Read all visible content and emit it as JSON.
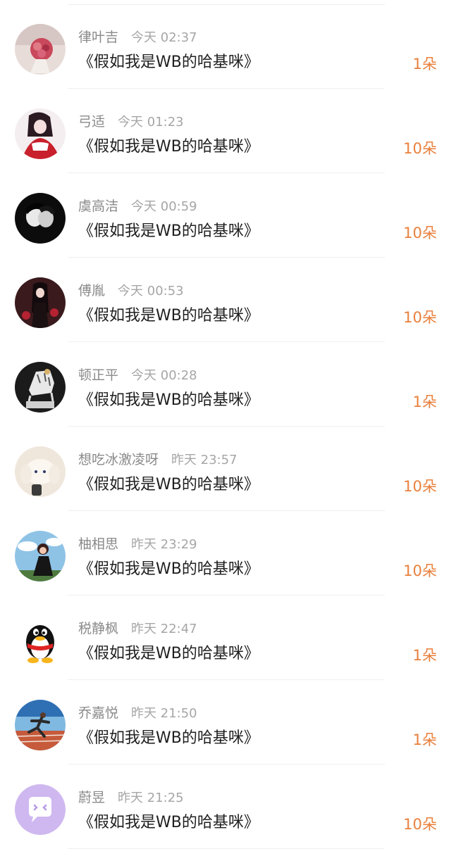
{
  "gift_list": {
    "items": [
      {
        "name": "律叶吉",
        "time": "今天 02:37",
        "message": "《假如我是WB的哈基咪》",
        "count": "1朵",
        "avatar_icon": "bouquet-photo-icon"
      },
      {
        "name": "弓适",
        "time": "今天 01:23",
        "message": "《假如我是WB的哈基咪》",
        "count": "10朵",
        "avatar_icon": "anime-girl-avatar-icon"
      },
      {
        "name": "虞高洁",
        "time": "今天 00:59",
        "message": "《假如我是WB的哈基咪》",
        "count": "10朵",
        "avatar_icon": "dark-couple-avatar-icon"
      },
      {
        "name": "傅胤",
        "time": "今天 00:53",
        "message": "《假如我是WB的哈基咪》",
        "count": "10朵",
        "avatar_icon": "dark-anime-avatar-icon"
      },
      {
        "name": "顿正平",
        "time": "今天 00:28",
        "message": "《假如我是WB的哈基咪》",
        "count": "1朵",
        "avatar_icon": "tiger-statue-avatar-icon"
      },
      {
        "name": "想吃冰激凌呀",
        "time": "昨天 23:57",
        "message": "《假如我是WB的哈基咪》",
        "count": "10朵",
        "avatar_icon": "cinnamoroll-plush-avatar-icon"
      },
      {
        "name": "柚相思",
        "time": "昨天 23:29",
        "message": "《假如我是WB的哈基咪》",
        "count": "10朵",
        "avatar_icon": "sky-portrait-avatar-icon"
      },
      {
        "name": "税静枫",
        "time": "昨天 22:47",
        "message": "《假如我是WB的哈基咪》",
        "count": "1朵",
        "avatar_icon": "qq-penguin-avatar-icon"
      },
      {
        "name": "乔嘉悦",
        "time": "昨天 21:50",
        "message": "《假如我是WB的哈基咪》",
        "count": "1朵",
        "avatar_icon": "runner-avatar-icon"
      },
      {
        "name": "蔚昱",
        "time": "昨天 21:25",
        "message": "《假如我是WB的哈基咪》",
        "count": "10朵",
        "avatar_icon": "purple-chat-bubble-avatar-icon"
      }
    ]
  },
  "colors": {
    "name": "#8a8a8a",
    "time": "#a6a6a6",
    "message": "#1f1f1f",
    "count": "#e9803c",
    "divider": "#efefef"
  }
}
